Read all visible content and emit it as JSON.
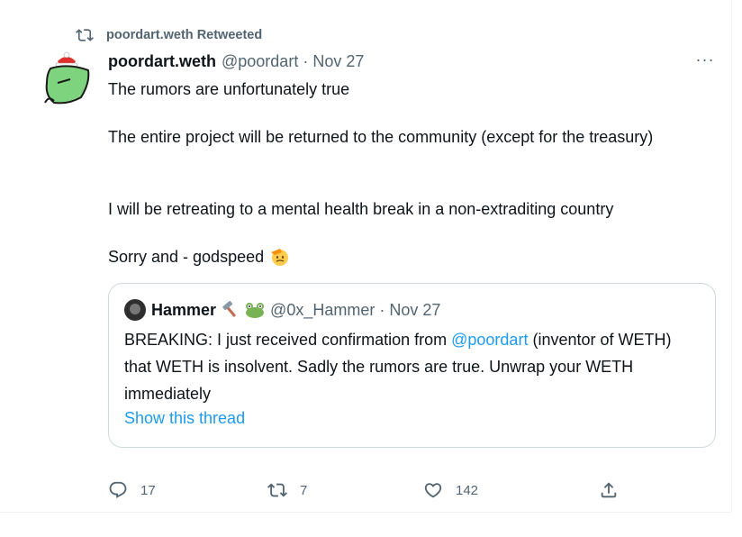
{
  "retweet_context": {
    "text": "poordart.weth Retweeted",
    "icon": "retweet-icon"
  },
  "tweet": {
    "author_name": "poordart.weth",
    "author_handle": "@poordart",
    "separator": "·",
    "date": "Nov 27",
    "more_label": "···",
    "paragraphs": [
      "The rumors are unfortunately true",
      "The entire project will be returned to the community (except for the treasury)",
      "I will be retreating to a mental health break in a non-extraditing country",
      "Sorry and - godspeed"
    ],
    "salute_emoji": "salute-emoji"
  },
  "quote": {
    "author_name": "Hammer",
    "author_emojis": [
      "hammer-emoji",
      "frog-emoji"
    ],
    "author_handle": "@0x_Hammer",
    "separator": "·",
    "date": "Nov 27",
    "text_before_mention": "BREAKING: I just received confirmation from ",
    "mention": "@poordart",
    "text_after_mention": " (inventor of WETH) that WETH is insolvent. Sadly the rumors are true. Unwrap your WETH immediately",
    "show_thread": "Show this thread"
  },
  "actions": {
    "reply_count": "17",
    "retweet_count": "7",
    "like_count": "142"
  },
  "colors": {
    "accent": "#1d9bf0",
    "secondary_text": "#536471",
    "primary_text": "#0f1419",
    "border": "#cfd9de",
    "avatar_green": "#7ed47e",
    "hat_red": "#e0302b"
  }
}
